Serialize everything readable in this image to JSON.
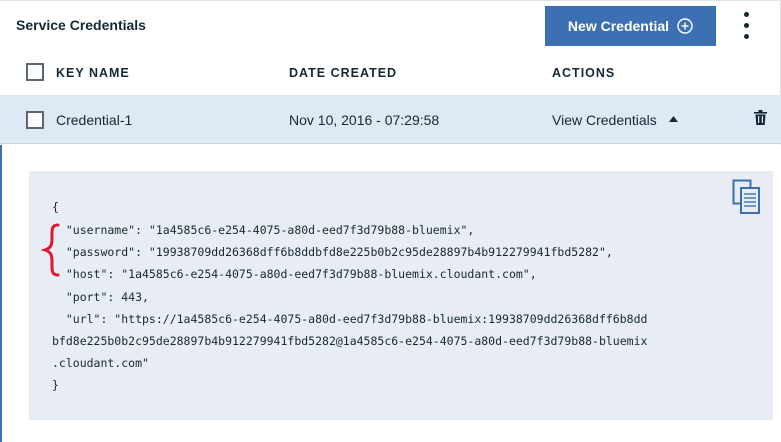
{
  "header": {
    "title": "Service Credentials",
    "new_button_label": "New Credential"
  },
  "table": {
    "columns": [
      "KEY NAME",
      "DATE CREATED",
      "ACTIONS"
    ],
    "rows": [
      {
        "key_name": "Credential-1",
        "date_created": "Nov 10, 2016 - 07:29:58",
        "action_label": "View Credentials"
      }
    ]
  },
  "credentials": {
    "lines": [
      "{",
      "  \"username\": \"1a4585c6-e254-4075-a80d-eed7f3d79b88-bluemix\",",
      "  \"password\": \"19938709dd26368dff6b8ddbfd8e225b0b2c95de28897b4b912279941fbd5282\",",
      "  \"host\": \"1a4585c6-e254-4075-a80d-eed7f3d79b88-bluemix.cloudant.com\",",
      "  \"port\": 443,",
      "  \"url\": \"https://1a4585c6-e254-4075-a80d-eed7f3d79b88-bluemix:19938709dd26368dff6b8dd",
      "bfd8e225b0b2c95de28897b4b912279941fbd5282@1a4585c6-e254-4075-a80d-eed7f3d79b88-bluemix",
      ".cloudant.com\"",
      "}"
    ]
  },
  "colors": {
    "primary_button": "#3d70b2",
    "selected_row": "#dfe9f5",
    "code_background": "#e8edf3",
    "annotation_brace": "#e0182d"
  },
  "icons": [
    "plus-circle-icon",
    "overflow-menu-icon",
    "caret-up-icon",
    "trash-icon",
    "copy-icon",
    "annotation-brace-icon"
  ]
}
